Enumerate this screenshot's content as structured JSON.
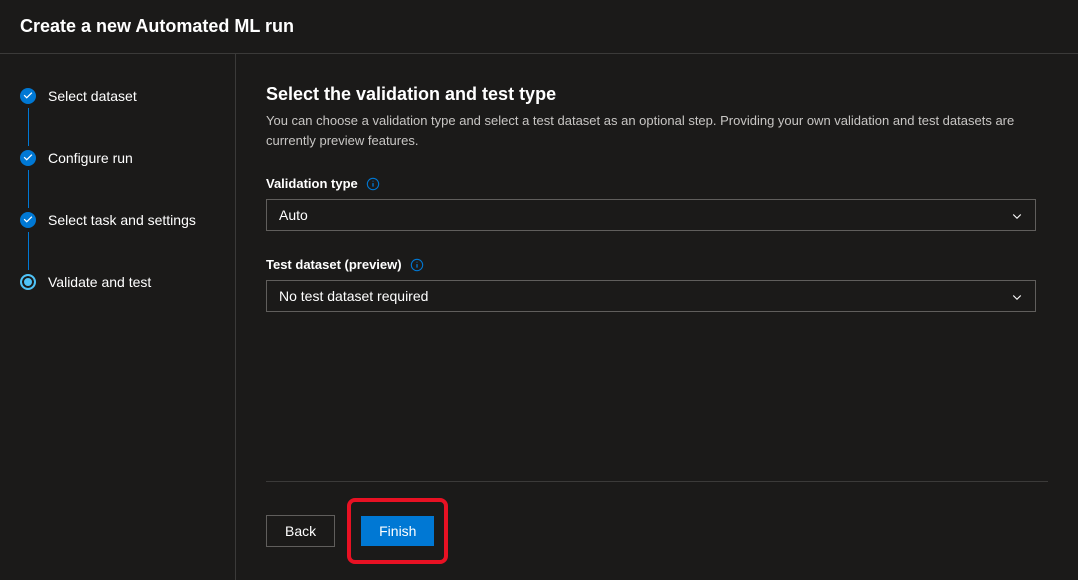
{
  "header": {
    "title": "Create a new Automated ML run"
  },
  "sidebar": {
    "steps": [
      {
        "label": "Select dataset",
        "status": "completed"
      },
      {
        "label": "Configure run",
        "status": "completed"
      },
      {
        "label": "Select task and settings",
        "status": "completed"
      },
      {
        "label": "Validate and test",
        "status": "current"
      }
    ]
  },
  "content": {
    "title": "Select the validation and test type",
    "subtitle": "You can choose a validation type and select a test dataset as an optional step. Providing your own validation and test datasets are currently preview features.",
    "validation_label": "Validation type",
    "validation_value": "Auto",
    "test_label": "Test dataset (preview)",
    "test_value": "No test dataset required"
  },
  "footer": {
    "back_label": "Back",
    "finish_label": "Finish"
  }
}
